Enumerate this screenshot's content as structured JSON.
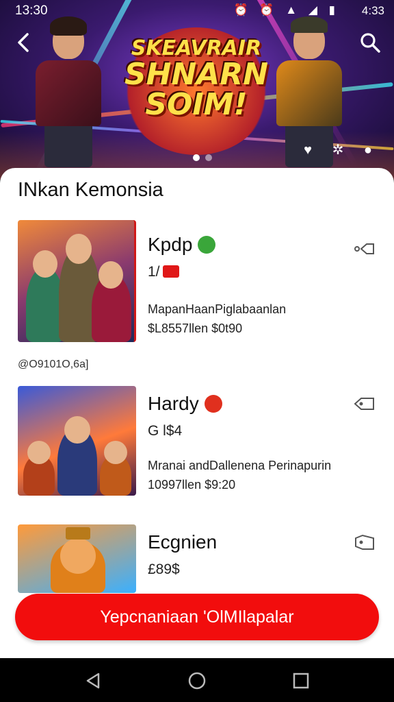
{
  "status_bar": {
    "time": "13:30",
    "icons": "⏰ ⏰ ▲ ◢ ▮",
    "right_label": "4:33"
  },
  "hero": {
    "banner_line1": "SKEAVRAIR",
    "banner_line2": "SHNARN",
    "banner_line3": "SOIM!",
    "back_icon": "chevron-left-icon",
    "search_icon": "search-icon",
    "hero_icons": "♥ ✲ ●"
  },
  "section": {
    "title": "INkan Kemonsia"
  },
  "items": [
    {
      "name": "Kpdp",
      "price": "1/",
      "desc": "MapanHaanPiglabaanlan",
      "meta": "$L8557llen $0t90",
      "badge_color": "#3aa63a"
    },
    {
      "name": "Hardy",
      "price": "G l$4",
      "desc": "Mranai andDallenena Perinapurin",
      "meta": "10997llen $9:20",
      "badge_color": "#e0301e"
    },
    {
      "name": "Ecgnien",
      "price": "£89$",
      "desc": "",
      "meta": "",
      "badge_color": ""
    }
  ],
  "stamp": "@O9101O,6a]",
  "cta": {
    "label": "Yepcnaniaan 'OlMIlapalar"
  },
  "nav": {
    "back": "back-triangle-icon",
    "home": "home-circle-icon",
    "recents": "recents-square-icon"
  }
}
